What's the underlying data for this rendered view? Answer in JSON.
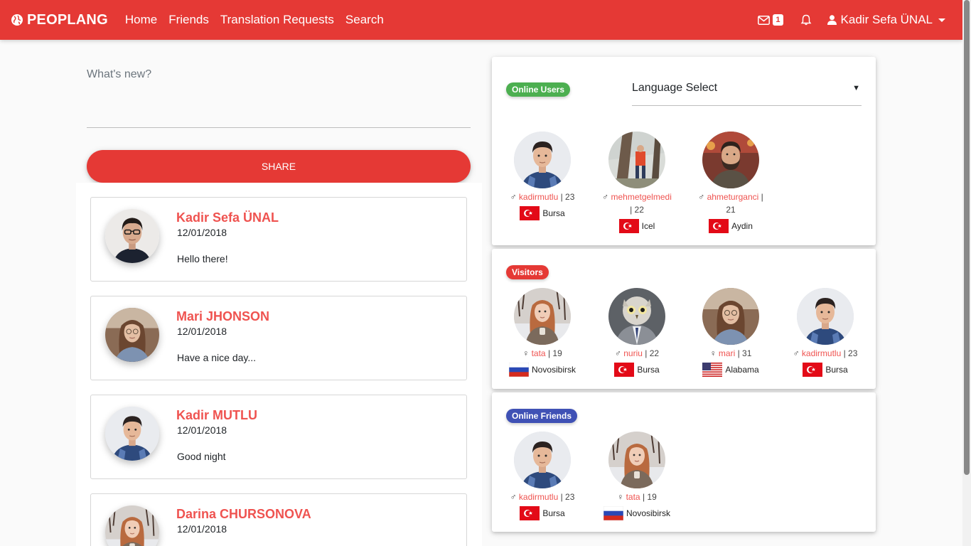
{
  "brand": "PEOPLANG",
  "nav": [
    "Home",
    "Friends",
    "Translation Requests",
    "Search"
  ],
  "header": {
    "message_count": "1",
    "user_name": "Kadir Sefa ÜNAL"
  },
  "composer": {
    "placeholder": "What's new?",
    "share_label": "SHARE"
  },
  "posts": [
    {
      "name": "Kadir Sefa ÜNAL",
      "date": "12/01/2018",
      "text": "Hello there!"
    },
    {
      "name": "Mari JHONSON",
      "date": "12/01/2018",
      "text": "Have a nice day..."
    },
    {
      "name": "Kadir MUTLU",
      "date": "12/01/2018",
      "text": "Good night"
    },
    {
      "name": "Darina CHURSONOVA",
      "date": "12/01/2018",
      "text": ""
    }
  ],
  "online_users": {
    "title": "Online Users",
    "language_select": "Language Select",
    "users": [
      {
        "gender": "♂",
        "username": "kadirmutlu",
        "age": "| 23",
        "country": "tr",
        "city": "Bursa"
      },
      {
        "gender": "♂",
        "username": "mehmetgelmedi",
        "age": "| 22",
        "country": "tr",
        "city": "Icel"
      },
      {
        "gender": "♂",
        "username": "ahmeturganci",
        "age": "| 21",
        "country": "tr",
        "city": "Aydin"
      }
    ]
  },
  "visitors": {
    "title": "Visitors",
    "users": [
      {
        "gender": "♀",
        "username": "tata",
        "age": "| 19",
        "country": "ru",
        "city": "Novosibirsk"
      },
      {
        "gender": "♂",
        "username": "nuriu",
        "age": "| 22",
        "country": "tr",
        "city": "Bursa"
      },
      {
        "gender": "♀",
        "username": "mari",
        "age": "| 31",
        "country": "us",
        "city": "Alabama"
      },
      {
        "gender": "♂",
        "username": "kadirmutlu",
        "age": "| 23",
        "country": "tr",
        "city": "Bursa"
      }
    ]
  },
  "online_friends": {
    "title": "Online Friends",
    "users": [
      {
        "gender": "♂",
        "username": "kadirmutlu",
        "age": "| 23",
        "country": "tr",
        "city": "Bursa"
      },
      {
        "gender": "♀",
        "username": "tata",
        "age": "| 19",
        "country": "ru",
        "city": "Novosibirsk"
      }
    ]
  },
  "colors": {
    "primary": "#e53935",
    "name_accent": "#ef5350",
    "online_pill": "#4caf50",
    "friends_pill": "#3f51b5"
  }
}
